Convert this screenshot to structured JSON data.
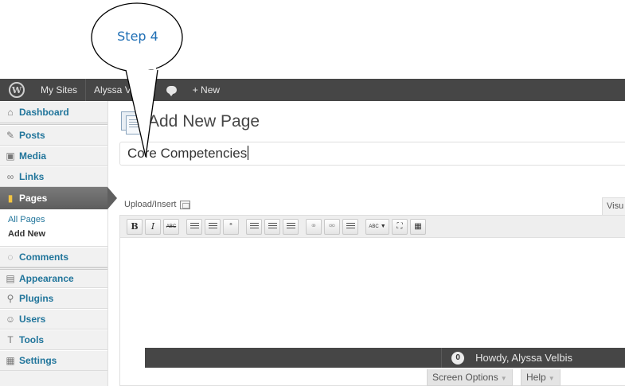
{
  "annotation": {
    "callout_text": "Step 4"
  },
  "admin_bar": {
    "logo": "wordpress-logo-icon",
    "my_sites": "My Sites",
    "site_name": "Alyssa Velbis",
    "comments_icon": "comment-bubble-icon",
    "new_label": "+ New"
  },
  "sidebar": {
    "items": [
      {
        "label": "Dashboard",
        "icon": "home-icon"
      },
      {
        "label": "Posts",
        "icon": "pin-icon"
      },
      {
        "label": "Media",
        "icon": "media-icon"
      },
      {
        "label": "Links",
        "icon": "link-icon"
      },
      {
        "label": "Pages",
        "icon": "pages-icon"
      },
      {
        "label": "Comments",
        "icon": "comment-icon"
      },
      {
        "label": "Appearance",
        "icon": "appearance-icon"
      },
      {
        "label": "Plugins",
        "icon": "plugin-icon"
      },
      {
        "label": "Users",
        "icon": "users-icon"
      },
      {
        "label": "Tools",
        "icon": "tools-icon"
      },
      {
        "label": "Settings",
        "icon": "settings-icon"
      }
    ],
    "submenu": {
      "all_pages": "All Pages",
      "add_new": "Add New"
    }
  },
  "main": {
    "heading": "Add New Page",
    "title_value": "Core Competencies",
    "upload_label": "Upload/Insert",
    "visual_tab": "Visu",
    "toolbar": {
      "bold": "B",
      "italic": "I",
      "strike": "ABC",
      "quote": "“",
      "spell": "ABC"
    }
  },
  "footer": {
    "notification_count": "0",
    "howdy": "Howdy, Alyssa Velbis",
    "screen_options": "Screen Options",
    "help": "Help"
  }
}
